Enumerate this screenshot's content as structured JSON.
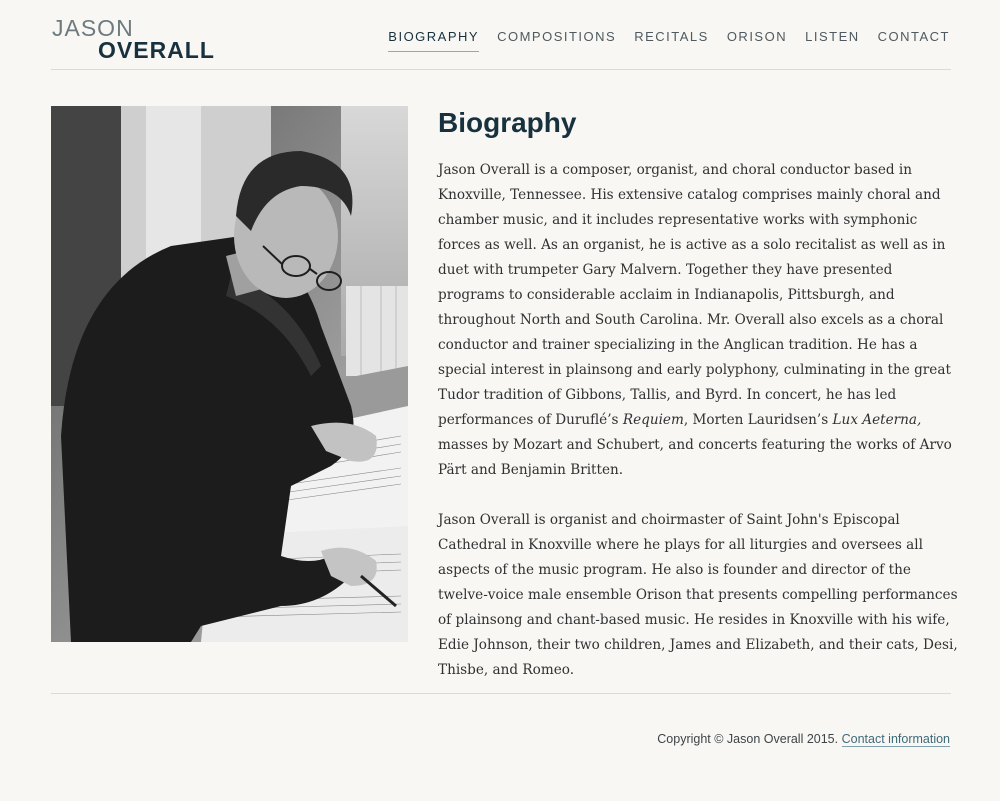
{
  "site": {
    "logo_line1": "JASON",
    "logo_line2": "OVERALL"
  },
  "nav": {
    "items": [
      {
        "label": "BIOGRAPHY",
        "active": true
      },
      {
        "label": "COMPOSITIONS",
        "active": false
      },
      {
        "label": "RECITALS",
        "active": false
      },
      {
        "label": "ORISON",
        "active": false
      },
      {
        "label": "LISTEN",
        "active": false
      },
      {
        "label": "CONTACT",
        "active": false
      }
    ]
  },
  "main": {
    "title": "Biography",
    "para1": {
      "a": "Jason Overall is a composer, organist, and choral conductor based in Knoxville, Tennessee. His extensive catalog comprises mainly choral and chamber music, and it includes representative works with symphonic forces as well. As an organist, he is active as a solo recitalist as well as in duet with trumpeter Gary Malvern. Together they have presented programs to considerable acclaim in Indianapolis, Pittsburgh, and throughout North and South Carolina. Mr. Overall also excels as a choral conductor and trainer specializing in the Anglican tradition. He has a special interest in plainsong and early polyphony, culminating in the great Tudor tradition of Gibbons, Tallis, and Byrd. In concert, he has led performances of Duruflé’s ",
      "em1": "Requiem",
      "b": ", Morten Lauridsen’s ",
      "em2": "Lux Aeterna,",
      "c": " masses by Mozart and Schubert, and concerts featuring the works of Arvo Pärt and Benjamin Britten."
    },
    "para2": "Jason Overall is organist and choirmaster of Saint John's Episcopal Cathedral in Knoxville where he plays for all liturgies and oversees all aspects of the music program. He also is founder and director of the twelve-voice male ensemble Orison that presents compelling performances of plainsong and chant-based music. He resides in Knoxville with his wife, Edie Johnson, their two children, James and Elizabeth, and their cats, Desi, Thisbe, and Romeo."
  },
  "footer": {
    "copyright": "Copyright © Jason Overall 2015.",
    "contact_link": "Contact information"
  },
  "colors": {
    "background": "#f9f7f3",
    "heading": "#17313f",
    "logo_light": "#6d7b80",
    "link": "#3d6a7a"
  }
}
